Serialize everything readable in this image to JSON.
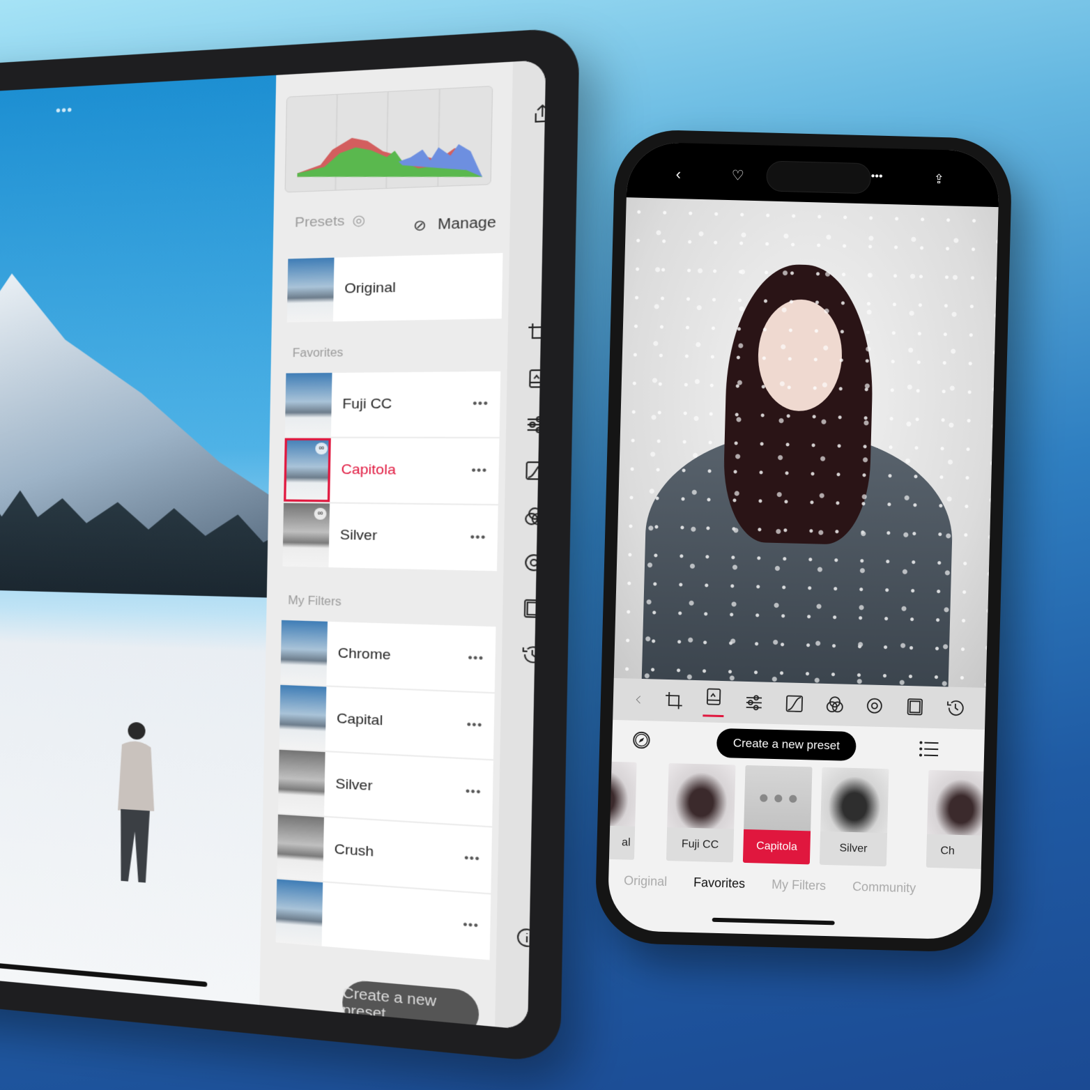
{
  "colors": {
    "accent": "#e0173e",
    "panel": "#ececec",
    "toolbar": "#e2e2e2"
  },
  "ipad": {
    "photo_menu": "•••",
    "presets_label": "Presets",
    "manage_label": "Manage",
    "original": "Original",
    "favorites_header": "Favorites",
    "favorites": [
      {
        "name": "Fuji CC",
        "selected": false
      },
      {
        "name": "Capitola",
        "selected": true
      },
      {
        "name": "Silver",
        "selected": false
      }
    ],
    "my_filters_header": "My Filters",
    "my_filters": [
      {
        "name": "Chrome"
      },
      {
        "name": "Capital"
      },
      {
        "name": "Silver"
      },
      {
        "name": "Crush"
      },
      {
        "name": ""
      }
    ],
    "more": "•••",
    "create_preset": "Create a new preset",
    "tools": [
      "share-icon",
      "crop-icon",
      "presets-icon",
      "sliders-icon",
      "curve-icon",
      "color-mixer-icon",
      "selective-color-icon",
      "frame-icon",
      "history-icon",
      "info-icon"
    ]
  },
  "phone": {
    "top_icons": [
      "back-icon",
      "heart-icon",
      "more-icon",
      "share-icon"
    ],
    "more": "•••",
    "tools": [
      "chevron-left-icon",
      "crop-icon",
      "presets-icon",
      "sliders-icon",
      "curve-icon",
      "color-mixer-icon",
      "selective-color-icon",
      "frame-icon",
      "history-icon"
    ],
    "active_tool": "presets-icon",
    "create_preset": "Create a new preset",
    "thumbnails": [
      {
        "name": "al"
      },
      {
        "name": "Fuji CC"
      },
      {
        "name": "Capitola",
        "selected": true
      },
      {
        "name": "Silver"
      },
      {
        "name": "Ch"
      }
    ],
    "tabs": [
      {
        "label": "Original"
      },
      {
        "label": "Favorites",
        "active": true
      },
      {
        "label": "My Filters"
      },
      {
        "label": "Community"
      }
    ]
  }
}
